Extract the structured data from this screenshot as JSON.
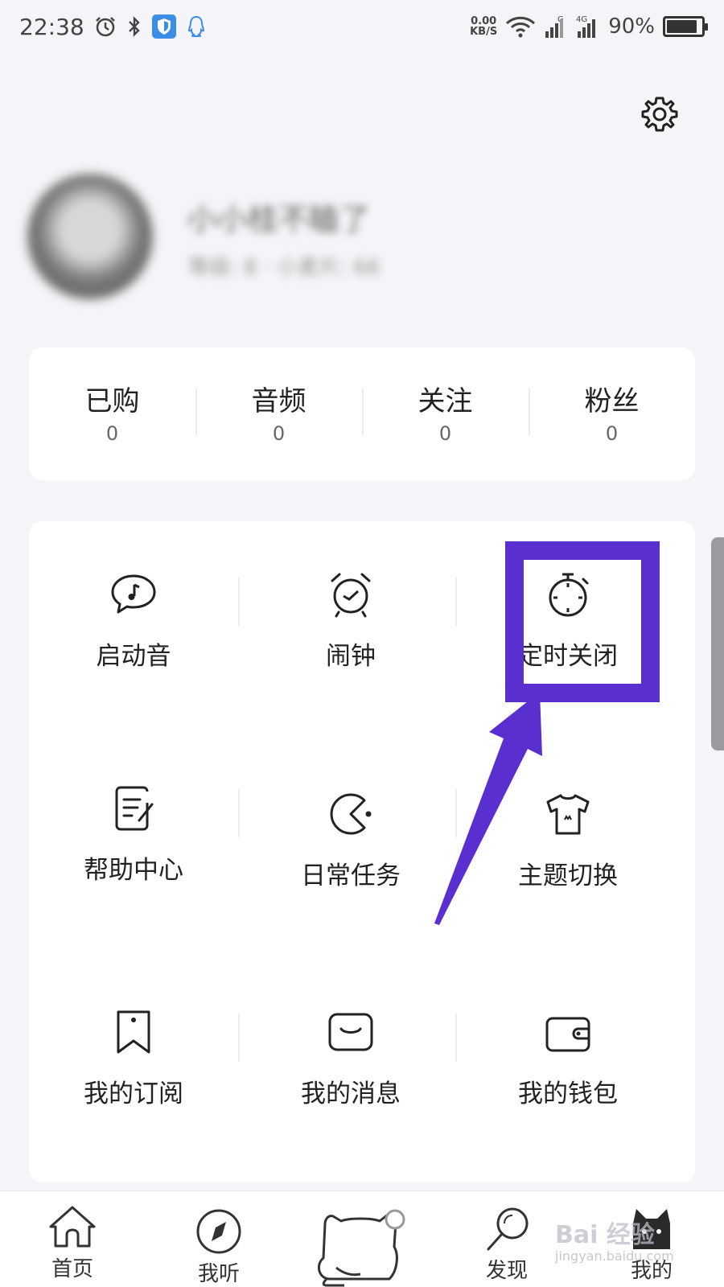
{
  "status_bar": {
    "time": "22:38",
    "net_speed_value": "0.00",
    "net_speed_unit": "KB/S",
    "signal_1_label": "G",
    "signal_2_label": "4G",
    "battery": "90%",
    "battery_level": 0.9
  },
  "profile": {
    "username": "小小桂不瞌了",
    "stats_line": "等级: 8  ·  小麦片: 66"
  },
  "stats": [
    {
      "label": "已购",
      "value": "0"
    },
    {
      "label": "音频",
      "value": "0"
    },
    {
      "label": "关注",
      "value": "0"
    },
    {
      "label": "粉丝",
      "value": "0"
    }
  ],
  "features": [
    {
      "label": "启动音",
      "icon": "music-bubble-icon"
    },
    {
      "label": "闹钟",
      "icon": "alarm-clock-icon"
    },
    {
      "label": "定时关闭",
      "icon": "timer-icon"
    },
    {
      "label": "帮助中心",
      "icon": "edit-note-icon"
    },
    {
      "label": "日常任务",
      "icon": "pacman-icon"
    },
    {
      "label": "主题切换",
      "icon": "tshirt-icon"
    },
    {
      "label": "我的订阅",
      "icon": "bookmark-icon"
    },
    {
      "label": "我的消息",
      "icon": "message-icon"
    },
    {
      "label": "我的钱包",
      "icon": "wallet-icon"
    }
  ],
  "annotation": {
    "color": "#5a2fcf",
    "target": "定时关闭"
  },
  "bottom_nav": [
    {
      "label": "首页",
      "icon": "home-icon"
    },
    {
      "label": "我听",
      "icon": "compass-icon"
    },
    {
      "label": "",
      "icon": "cat-mascot-icon"
    },
    {
      "label": "发现",
      "icon": "discover-search-icon"
    },
    {
      "label": "我的",
      "icon": "profile-cat-icon"
    }
  ],
  "watermark": {
    "text": "Bai 经验",
    "url": "jingyan.baidu.com"
  }
}
